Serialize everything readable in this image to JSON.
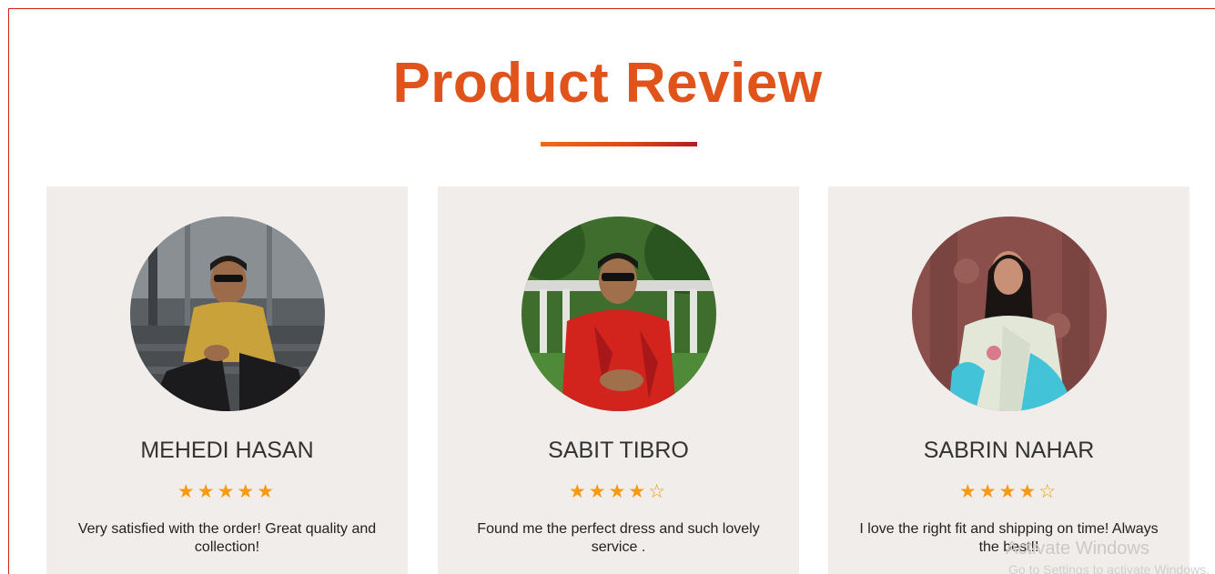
{
  "section": {
    "title": "Product Review"
  },
  "colors": {
    "title": "#e0531a",
    "star": "#f59a12",
    "card_bg": "#f0edea"
  },
  "reviews": [
    {
      "name": "MEHEDI HASAN",
      "rating": 5,
      "stars": "★★★★★",
      "text": "Very satisfied with the order! Great quality and collection!",
      "avatar_icon": "person-photo"
    },
    {
      "name": "SABIT TIBRO",
      "rating": 4,
      "stars": "★★★★☆",
      "text": "Found me the perfect dress and such lovely service .",
      "avatar_icon": "person-photo"
    },
    {
      "name": "SABRIN NAHAR",
      "rating": 4,
      "stars": "★★★★☆",
      "text": "I love the right fit and shipping on time! Always the best!!",
      "avatar_icon": "person-photo"
    }
  ],
  "watermark": {
    "title": "Activate Windows",
    "subtitle": "Go to Settings to activate Windows."
  }
}
